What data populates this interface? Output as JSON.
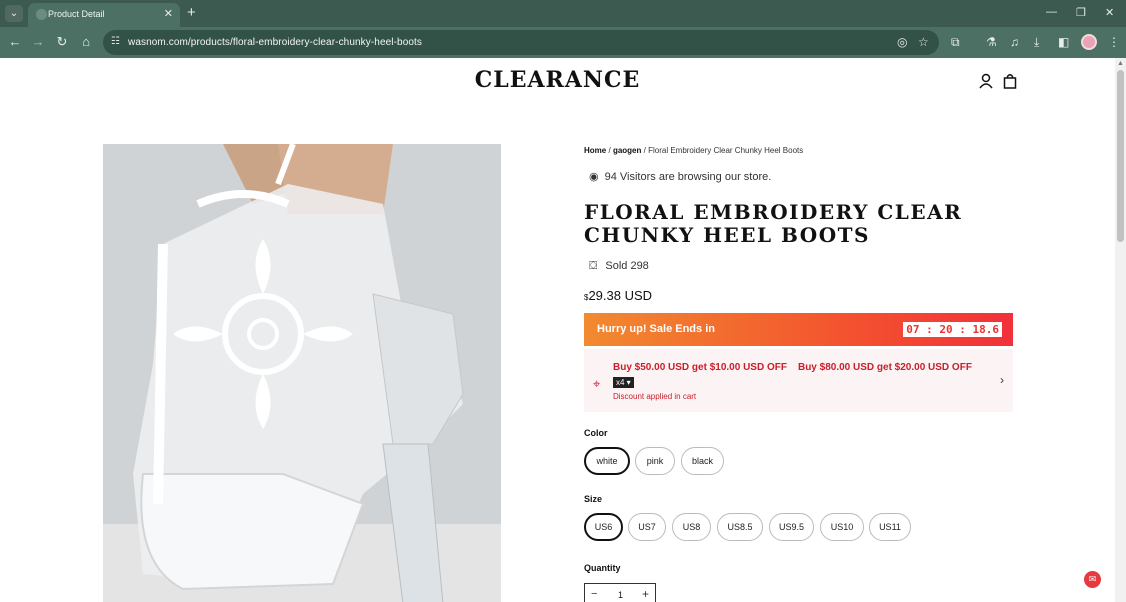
{
  "browser": {
    "tab_title": "Product Detail",
    "url": "wasnom.com/products/floral-embroidery-clear-chunky-heel-boots"
  },
  "header": {
    "brand": "CLEARANCE"
  },
  "breadcrumb": {
    "home": "Home",
    "category": "gaogen",
    "current": "Floral Embroidery Clear Chunky Heel Boots",
    "separator": "/"
  },
  "product": {
    "visitors_text": "94 Visitors are browsing our store.",
    "title": "FLORAL EMBROIDERY CLEAR CHUNKY HEEL BOOTS",
    "sold_text": "Sold 298",
    "price_symbol": "$",
    "price": "29.38 USD",
    "image_alt": "White floral embroidery clear chunky heel boot"
  },
  "sale": {
    "label": "Hurry up! Sale Ends in",
    "countdown": "07 : 20 : 18.6"
  },
  "discount": {
    "offer_1": "Buy $50.00 USD get $10.00 USD OFF",
    "offer_2": "Buy $80.00 USD get $20.00 USD OFF",
    "multiplier": "x4 ▾",
    "applied": "Discount applied in cart"
  },
  "color": {
    "label": "Color",
    "options": [
      "white",
      "pink",
      "black"
    ],
    "selected": "white"
  },
  "size": {
    "label": "Size",
    "options": [
      "US6",
      "US7",
      "US8",
      "US8.5",
      "US9.5",
      "US10",
      "US11"
    ],
    "selected": "US6"
  },
  "quantity": {
    "label": "Quantity",
    "value": "1",
    "minus": "−",
    "plus": "+"
  },
  "colors": {
    "chrome_dark": "#3c5a50",
    "chrome_toolbar": "#4d7064",
    "sale_orange": "#f28a2f",
    "sale_red": "#f2303a",
    "discount_red": "#c8202a"
  }
}
